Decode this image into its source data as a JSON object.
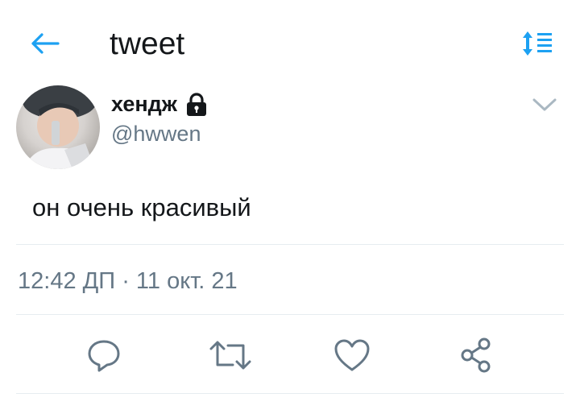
{
  "header": {
    "title": "tweet",
    "back_icon": "back-arrow-icon",
    "sort_icon": "sort-lines-icon",
    "accent_color": "#1da1f2"
  },
  "tweet": {
    "author": {
      "name": "хендж",
      "handle": "@hwwen",
      "locked": true
    },
    "text": "он очень красивый",
    "time": "12:42 ДП",
    "separator": "·",
    "date": "11 окт. 21",
    "actions": [
      {
        "icon": "reply-icon"
      },
      {
        "icon": "retweet-icon"
      },
      {
        "icon": "like-icon"
      },
      {
        "icon": "share-icon"
      }
    ]
  }
}
